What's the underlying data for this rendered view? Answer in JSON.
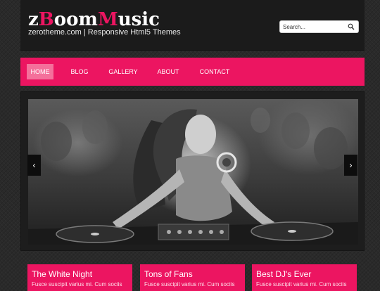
{
  "brand": {
    "logo_z": "z",
    "logo_b": "B",
    "logo_oom": "oom",
    "logo_m": "M",
    "logo_usic": "usic",
    "tagline": "zerotheme.com | Responsive Html5 Themes",
    "accent_color": "#ec1561"
  },
  "search": {
    "placeholder": "Search...",
    "icon": "search-icon"
  },
  "nav": {
    "items": [
      {
        "label": "HOME",
        "active": true
      },
      {
        "label": "BLOG",
        "active": false
      },
      {
        "label": "GALLERY",
        "active": false
      },
      {
        "label": "ABOUT",
        "active": false
      },
      {
        "label": "CONTACT",
        "active": false
      }
    ]
  },
  "slider": {
    "prev_icon": "chevron-left-icon",
    "next_icon": "chevron-right-icon",
    "prev_glyph": "‹",
    "next_glyph": "›"
  },
  "boxes": [
    {
      "title": "The White Night",
      "text": "Fusce suscipit varius mi. Cum sociis"
    },
    {
      "title": "Tons of Fans",
      "text": "Fusce suscipit varius mi. Cum sociis"
    },
    {
      "title": "Best DJ's Ever",
      "text": "Fusce suscipit varius mi. Cum sociis"
    }
  ]
}
